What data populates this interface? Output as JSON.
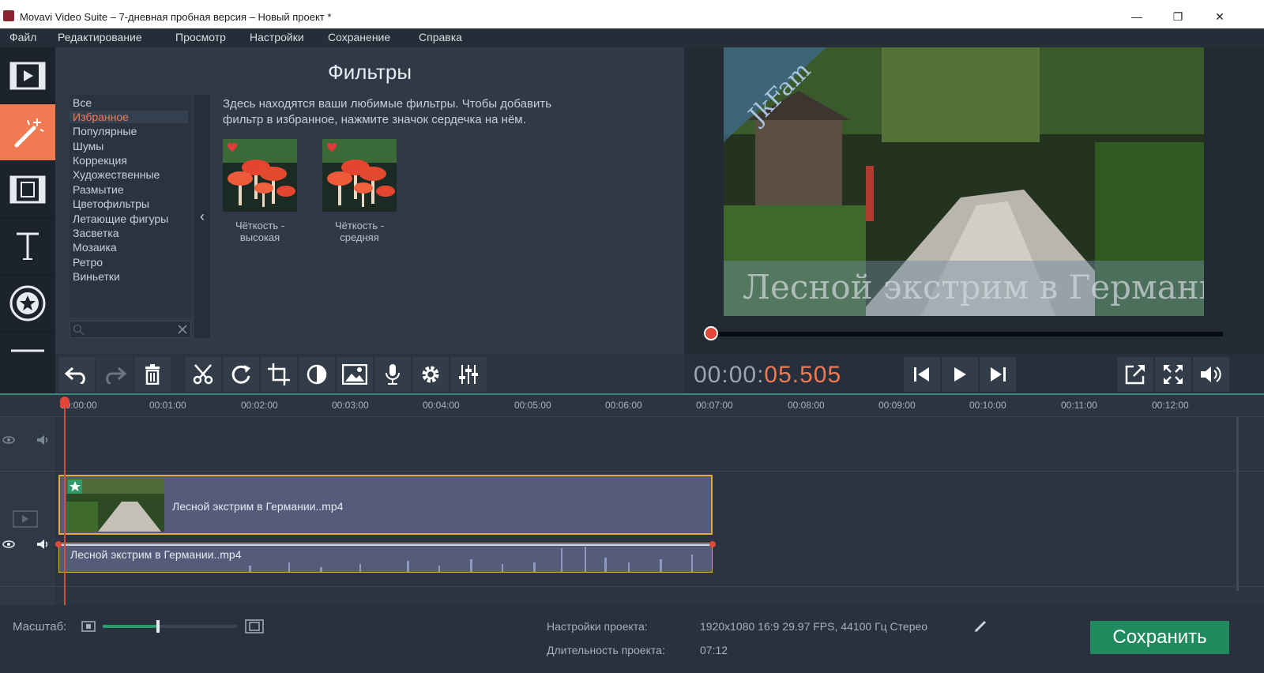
{
  "window": {
    "title": "Movavi Video Suite – 7-дневная пробная версия – Новый проект *"
  },
  "menu": [
    "Файл",
    "Редактирование",
    "Просмотр",
    "Настройки",
    "Сохранение",
    "Справка"
  ],
  "panel": {
    "title": "Фильтры",
    "categories": [
      "Все",
      "Избранное",
      "Популярные",
      "Шумы",
      "Коррекция",
      "Художественные",
      "Размытие",
      "Цветофильтры",
      "Летающие фигуры",
      "Засветка",
      "Мозаика",
      "Ретро",
      "Виньетки"
    ],
    "selected_category": "Избранное",
    "description_line1": "Здесь находятся ваши любимые фильтры. Чтобы добавить",
    "description_line2": "фильтр в избранное, нажмите значок сердечка на нём.",
    "filters": [
      {
        "line1": "Чёткость -",
        "line2": "высокая"
      },
      {
        "line1": "Чёткость -",
        "line2": "средняя"
      }
    ]
  },
  "preview": {
    "watermark": "JkFam",
    "overlay_text": "Лесной экстрим в Германии"
  },
  "playback": {
    "time_dim": "00:00:",
    "time_hl": "05.505"
  },
  "ruler": [
    "00:00:00",
    "00:01:00",
    "00:02:00",
    "00:03:00",
    "00:04:00",
    "00:05:00",
    "00:06:00",
    "00:07:00",
    "00:08:00",
    "00:09:00",
    "00:10:00",
    "00:11:00",
    "00:12:00"
  ],
  "timeline": {
    "video_clip": "Лесной экстрим в Германии..mp4",
    "audio_clip": "Лесной экстрим в Германии..mp4"
  },
  "status": {
    "scale_label": "Масштаб:",
    "scale_fraction": 0.41,
    "settings_label": "Настройки проекта:",
    "settings_value": "1920x1080 16:9 29.97 FPS, 44100 Гц Стерео",
    "duration_label": "Длительность проекта:",
    "duration_value": "07:12",
    "save_label": "Сохранить"
  },
  "colors": {
    "accent": "#f07a52",
    "save": "#1f8a5e",
    "clip_border": "#e3a93a"
  }
}
